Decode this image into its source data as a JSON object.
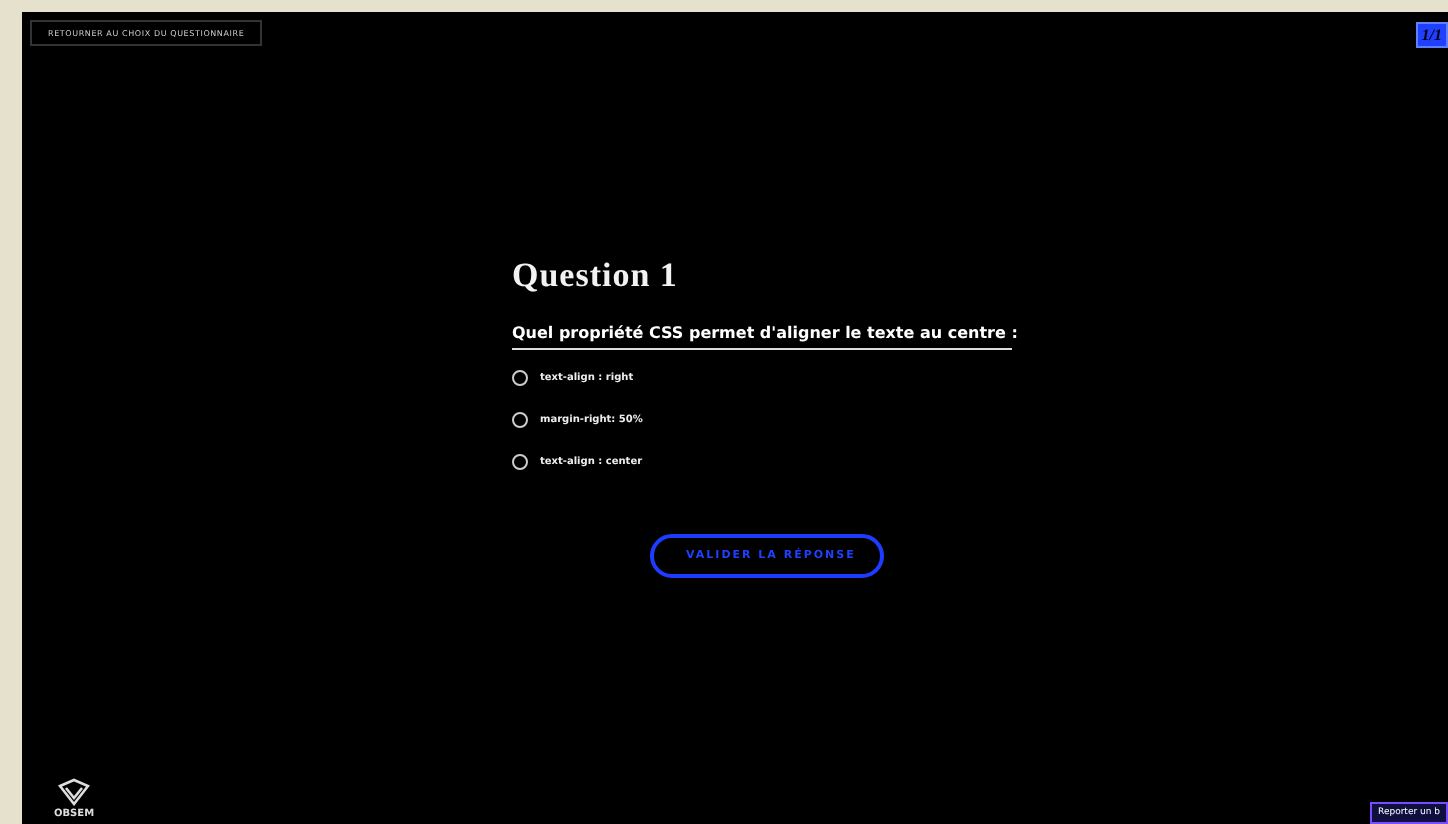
{
  "back_button": {
    "label": "RETOURNER AU CHOIX DU QUESTIONNAIRE"
  },
  "counter": "1/1",
  "question": {
    "title": "Question 1",
    "prompt": "Quel propriété CSS permet d'aligner le texte au centre :"
  },
  "options": [
    {
      "label": "text-align : right",
      "selected": false
    },
    {
      "label": "margin-right: 50%",
      "selected": false
    },
    {
      "label": "text-align : center",
      "selected": false
    }
  ],
  "submit_button": {
    "label": "VALIDER LA RÉPONSE"
  },
  "logo": {
    "text": "OBSEM"
  },
  "report_button": {
    "label": "Reporter un b"
  }
}
